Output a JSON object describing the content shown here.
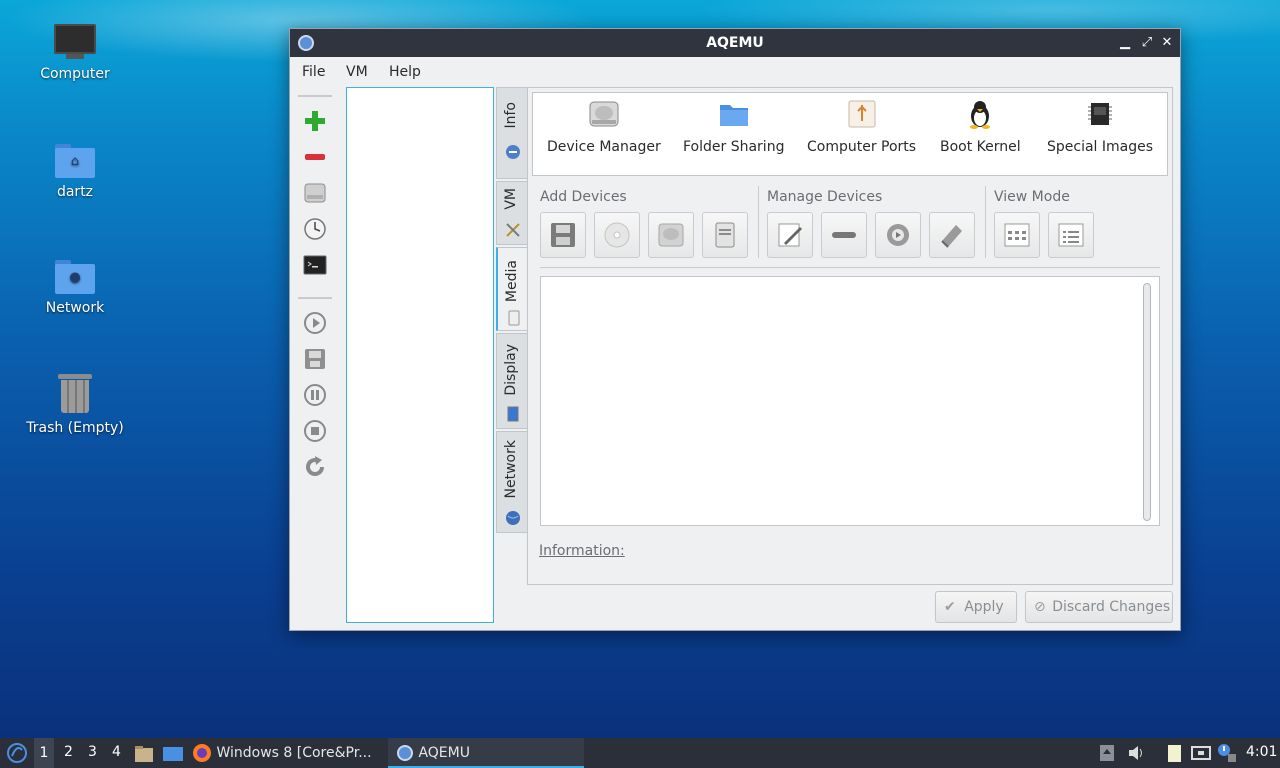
{
  "desktop": {
    "icons": [
      {
        "label": "Computer"
      },
      {
        "label": "dartz"
      },
      {
        "label": "Network"
      },
      {
        "label": "Trash (Empty)"
      }
    ]
  },
  "window": {
    "title": "AQEMU",
    "menu": [
      "File",
      "VM",
      "Help"
    ],
    "controls": {
      "minimize": "▁",
      "restore": "⤢",
      "close": "✕"
    },
    "left_toolbar": [
      {
        "icon": "add-icon"
      },
      {
        "icon": "remove-icon"
      },
      {
        "icon": "harddisk-icon"
      },
      {
        "icon": "clock-icon"
      },
      {
        "icon": "terminal-icon"
      },
      {
        "icon": "play-icon"
      },
      {
        "icon": "save-icon"
      },
      {
        "icon": "pause-icon"
      },
      {
        "icon": "stop-icon"
      },
      {
        "icon": "reset-icon"
      }
    ],
    "tabs": [
      {
        "label": "Info"
      },
      {
        "label": "VM"
      },
      {
        "label": "Media"
      },
      {
        "label": "Display"
      },
      {
        "label": "Network"
      }
    ],
    "devices": [
      {
        "label": "Device Manager"
      },
      {
        "label": "Folder Sharing"
      },
      {
        "label": "Computer Ports"
      },
      {
        "label": "Boot Kernel"
      },
      {
        "label": "Special Images"
      }
    ],
    "sections": {
      "add": "Add Devices",
      "manage": "Manage Devices",
      "view": "View Mode"
    },
    "information_label": "Information:",
    "buttons": {
      "apply": "Apply",
      "discard": "Discard Changes"
    }
  },
  "taskbar": {
    "workspaces": [
      "1",
      "2",
      "3",
      "4"
    ],
    "windows": [
      {
        "label": "Windows 8 [Core&Pr..."
      },
      {
        "label": "AQEMU"
      }
    ],
    "clock": "4:01"
  },
  "colors": {
    "accent": "#3daee9",
    "titlebar": "#2f343f",
    "taskbar": "#2b2f39"
  }
}
